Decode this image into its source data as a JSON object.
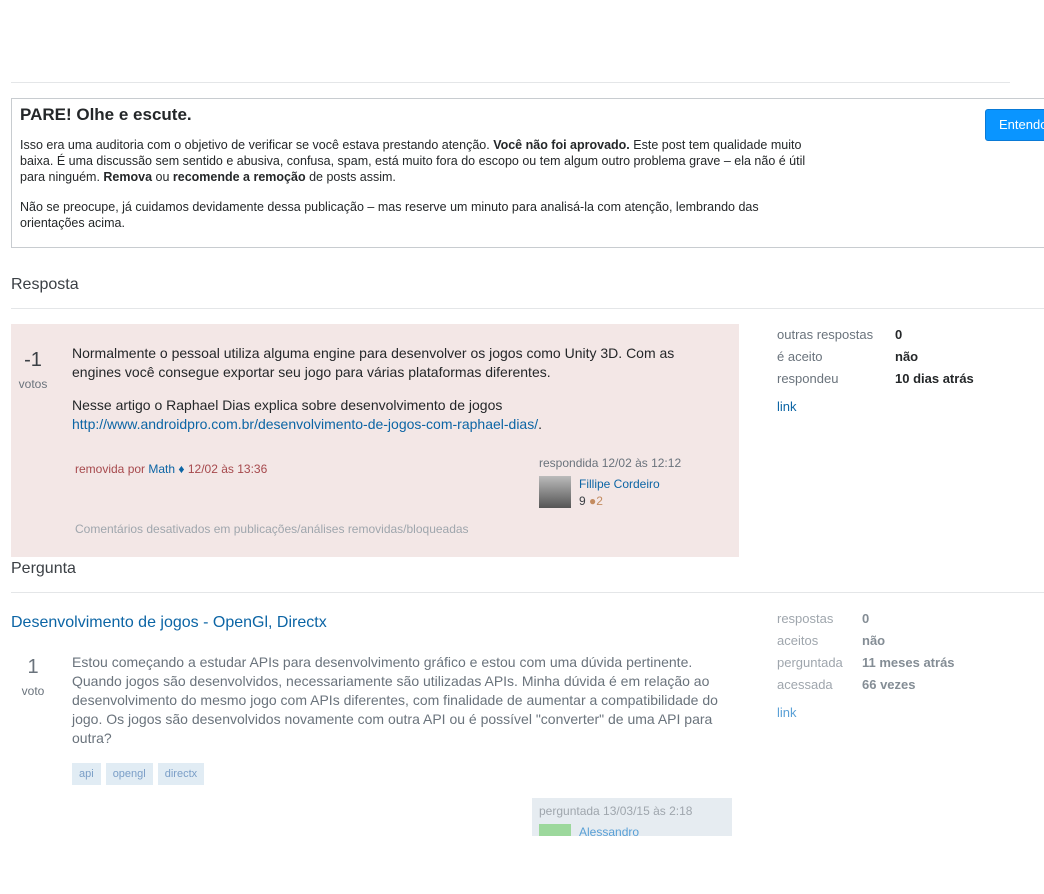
{
  "audit": {
    "title": "PARE! Olhe e escute.",
    "p1_a": "Isso era uma auditoria com o objetivo de verificar se você estava prestando atenção. ",
    "p1_b": "Você não foi aprovado.",
    "p1_c": " Este post tem qualidade muito baixa. É uma discussão sem sentido e abusiva, confusa, spam, está muito fora do escopo ou tem algum outro problema grave – ela não é útil para ninguém. ",
    "p1_d": "Remova",
    "p1_e": " ou ",
    "p1_f": "recomende a remoção",
    "p1_g": " de posts assim.",
    "p2": "Não se preocupe, já cuidamos devidamente dessa publicação – mas reserve um minuto para analisá-la com atenção, lembrando das orientações acima.",
    "button": "Entendo"
  },
  "answer_section": {
    "heading": "Resposta",
    "votes": "-1",
    "votes_label": "votos",
    "p1": "Normalmente o pessoal utiliza alguma engine para desenvolver os jogos como Unity 3D. Com as engines você consegue exportar seu jogo para várias plataformas diferentes.",
    "p2_text": "Nesse artigo o Raphael Dias explica sobre desenvolvimento de jogos",
    "p2_link": "http://www.androidpro.com.br/desenvolvimento-de-jogos-com-raphael-dias/",
    "p2_end": ".",
    "removed_prefix": "removida por ",
    "removed_by": "Math ♦",
    "removed_time": " 12/02 às 13:36",
    "answered_time": "respondida 12/02 às 12:12",
    "user_name": "Fillipe Cordeiro",
    "user_rep": "9",
    "user_badge": "●2",
    "comments_off": "Comentários desativados em publicações/análises removidas/bloqueadas",
    "stats": [
      {
        "k": "outras respostas",
        "v": "0"
      },
      {
        "k": "é aceito",
        "v": "não"
      },
      {
        "k": "respondeu",
        "v": "10 dias atrás"
      }
    ],
    "link": "link"
  },
  "question_section": {
    "heading": "Pergunta",
    "title": "Desenvolvimento de jogos - OpenGl, Directx",
    "votes": "1",
    "votes_label": "voto",
    "body": "Estou começando a estudar APIs para desenvolvimento gráfico e estou com uma dúvida pertinente. Quando jogos são desenvolvidos, necessariamente são utilizadas APIs. Minha dúvida é em relação ao desenvolvimento do mesmo jogo com APIs diferentes, com finalidade de aumentar a compatibilidade do jogo. Os jogos são desenvolvidos novamente com outra API ou é possível \"converter\" de uma API para outra?",
    "tags": [
      "api",
      "opengl",
      "directx"
    ],
    "asked_time": "perguntada 13/03/15 às 2:18",
    "asked_user": "Alessandro",
    "stats": [
      {
        "k": "respostas",
        "v": "0"
      },
      {
        "k": "aceitos",
        "v": "não"
      },
      {
        "k": "perguntada",
        "v": "11 meses atrás"
      },
      {
        "k": "acessada",
        "v": "66 vezes"
      }
    ],
    "link": "link"
  }
}
